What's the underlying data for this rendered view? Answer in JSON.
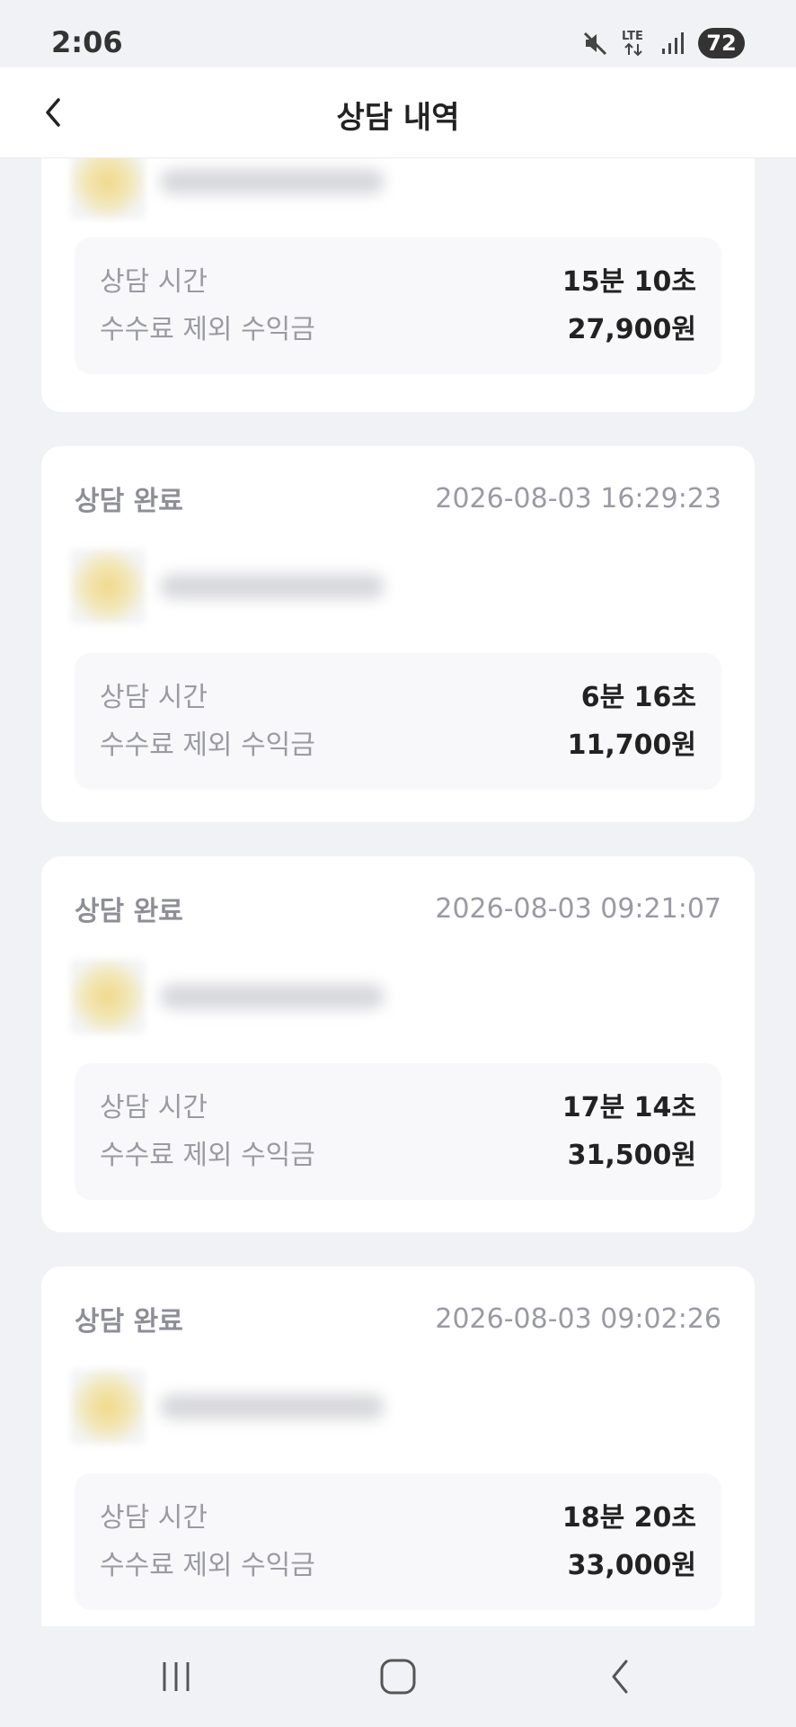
{
  "status_bar": {
    "time": "2:06",
    "battery": "72",
    "icons": [
      "mute-icon",
      "lte-icon",
      "signal-icon",
      "battery-icon"
    ]
  },
  "header": {
    "title": "상담 내역",
    "back_icon": "chevron-left-icon"
  },
  "records": [
    {
      "status": "",
      "datetime": "",
      "duration_label": "상담 시간",
      "duration": "15분 10초",
      "earnings_label": "수수료 제외 수익금",
      "earnings": "27,900원"
    },
    {
      "status": "상담 완료",
      "datetime": "2026-08-03 16:29:23",
      "duration_label": "상담 시간",
      "duration": "6분 16초",
      "earnings_label": "수수료 제외 수익금",
      "earnings": "11,700원"
    },
    {
      "status": "상담 완료",
      "datetime": "2026-08-03 09:21:07",
      "duration_label": "상담 시간",
      "duration": "17분 14초",
      "earnings_label": "수수료 제외 수익금",
      "earnings": "31,500원"
    },
    {
      "status": "상담 완료",
      "datetime": "2026-08-03 09:02:26",
      "duration_label": "상담 시간",
      "duration": "18분 20초",
      "earnings_label": "수수료 제외 수익금",
      "earnings": "33,000원"
    }
  ],
  "nav_bar": {
    "icons": [
      "recent-apps-icon",
      "home-icon",
      "back-icon"
    ]
  },
  "colors": {
    "background": "#f1f2f5",
    "card": "#ffffff",
    "info_box": "#f8f8fa",
    "muted_text": "#9a9ba2",
    "strong_text": "#222222"
  }
}
